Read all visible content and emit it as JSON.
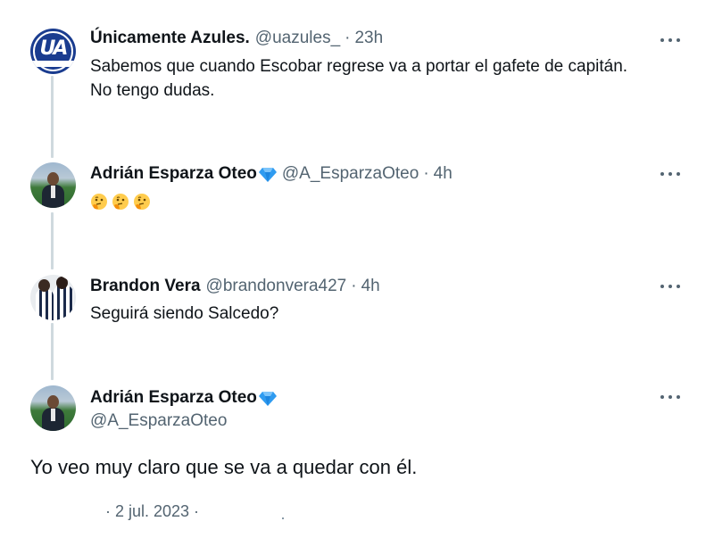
{
  "tweets": [
    {
      "name": "Únicamente Azules.",
      "handle": "@uazules_",
      "separator": "·",
      "time": "23h",
      "text_line1": "Sabemos que cuando Escobar regrese va a portar el gafete de capitán.",
      "text_line2": "No tengo dudas.",
      "avatar_letters": "UA"
    },
    {
      "name": "Adrián Esparza Oteo",
      "handle": "@A_EsparzaOteo",
      "separator": "·",
      "time": "4h",
      "verified_icon": "blue-diamond-icon",
      "emoji_icon": "thinking-face-icon",
      "emoji_count": 3
    },
    {
      "name": "Brandon Vera",
      "handle": "@brandonvera427",
      "separator": "·",
      "time": "4h",
      "text": "Seguirá siendo Salcedo?"
    }
  ],
  "main_tweet": {
    "name": "Adrián Esparza Oteo",
    "handle": "@A_EsparzaOteo",
    "verified_icon": "blue-diamond-icon",
    "text": "Yo veo muy claro que se va a quedar con él.",
    "meta": "· 2 jul. 2023 ·"
  },
  "colors": {
    "text": "#0f1419",
    "secondary": "#536471",
    "thread_line": "#cfd9de",
    "verified": "#1d9bf0"
  },
  "more_icon": "more-horizontal-icon"
}
